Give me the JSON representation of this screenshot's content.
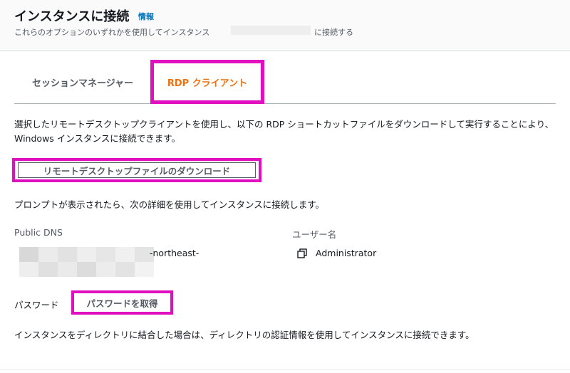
{
  "header": {
    "title": "インスタンスに接続",
    "info_link": "情報",
    "description_start": "これらのオプションのいずれかを使用してインスタンス",
    "description_end": "に接続する"
  },
  "tabs": [
    {
      "label": "セッションマネージャー",
      "active": false
    },
    {
      "label": "RDP クライアント",
      "active": true
    }
  ],
  "rdp": {
    "description": "選択したリモートデスクトップクライアントを使用し、以下の RDP ショートカットファイルをダウンロードして実行することにより、Windows インスタンスに接続できます。",
    "download_button": "リモートデスクトップファイルのダウンロード",
    "prompt_text": "プロンプトが表示されたら、次の詳細を使用してインスタンスに接続します。",
    "public_dns_label": "Public DNS",
    "public_dns_visible": "-northeast-",
    "username_label": "ユーザー名",
    "username_value": "Administrator",
    "password_label": "パスワード",
    "get_password_button": "パスワードを取得",
    "footer_text": "インスタンスをディレクトリに結合した場合は、ディレクトリの認証情報を使用してインスタンスに接続できます。"
  },
  "colors": {
    "active_tab": "#ec7211",
    "link": "#0073bb",
    "highlight": "#e010c0"
  },
  "icons": {
    "copy": "copy-icon"
  }
}
